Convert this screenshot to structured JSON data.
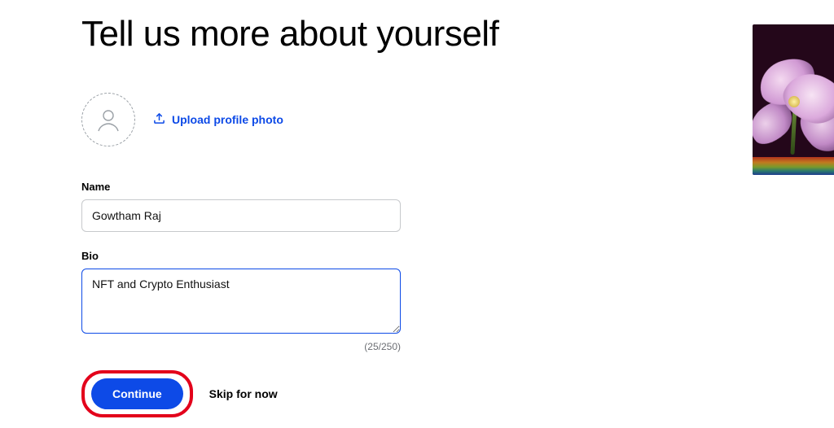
{
  "heading": "Tell us more about yourself",
  "upload": {
    "label": "Upload profile photo"
  },
  "fields": {
    "name": {
      "label": "Name",
      "value": "Gowtham Raj"
    },
    "bio": {
      "label": "Bio",
      "value": "NFT and Crypto Enthusiast",
      "counter": "(25/250)"
    }
  },
  "buttons": {
    "continue": "Continue",
    "skip": "Skip for now"
  }
}
